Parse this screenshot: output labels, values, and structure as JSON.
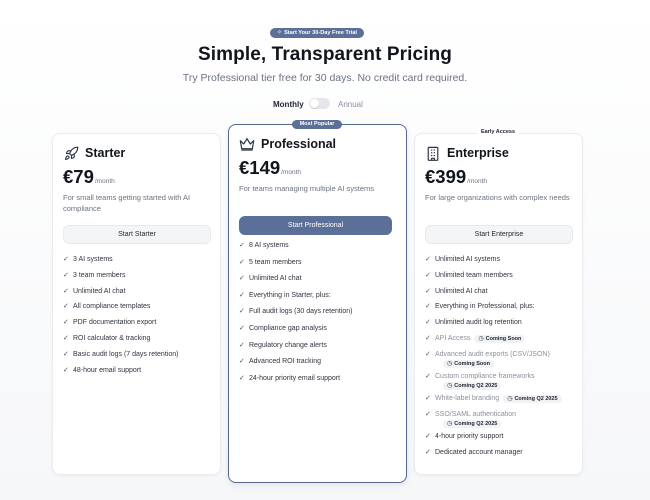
{
  "trial_badge": "Start Your 30-Day Free Trial",
  "title": "Simple, Transparent Pricing",
  "subtitle": "Try Professional tier free for 30 days. No credit card required.",
  "billing": {
    "monthly": "Monthly",
    "annual": "Annual",
    "selected": "Monthly"
  },
  "colors": {
    "accent": "#5b6f99",
    "text": "#11151c",
    "muted": "#6b7280"
  },
  "plans": {
    "starter": {
      "icon": "rocket-icon",
      "name": "Starter",
      "price": "€79",
      "period": "/month",
      "description": "For small teams getting started with AI compliance",
      "cta": "Start Starter",
      "features": [
        "3 AI systems",
        "3 team members",
        "Unlimited AI chat",
        "All compliance templates",
        "PDF documentation export",
        "ROI calculator & tracking",
        "Basic audit logs (7 days retention)",
        "48-hour email support"
      ]
    },
    "professional": {
      "badge": "Most Popular",
      "icon": "crown-icon",
      "name": "Professional",
      "price": "€149",
      "period": "/month",
      "description": "For teams managing multiple AI systems",
      "cta": "Start Professional",
      "features": [
        "8 AI systems",
        "5 team members",
        "Unlimited AI chat",
        "Everything in Starter, plus:",
        "Full audit logs (30 days retention)",
        "Compliance gap analysis",
        "Regulatory change alerts",
        "Advanced ROI tracking",
        "24-hour priority email support"
      ]
    },
    "enterprise": {
      "badge": "Early Access",
      "icon": "building-icon",
      "name": "Enterprise",
      "price": "€399",
      "period": "/month",
      "description": "For large organizations with complex needs",
      "cta": "Start Enterprise",
      "features": [
        {
          "text": "Unlimited AI systems"
        },
        {
          "text": "Unlimited team members"
        },
        {
          "text": "Unlimited AI chat"
        },
        {
          "text": "Everything in Professional, plus:"
        },
        {
          "text": "Unlimited audit log retention"
        },
        {
          "text": "API Access",
          "tag": "Coming Soon"
        },
        {
          "text": "Advanced audit exports (CSV/JSON)",
          "tag": "Coming Soon"
        },
        {
          "text": "Custom compliance frameworks",
          "tag": "Coming Q2 2025"
        },
        {
          "text": "White-label branding",
          "tag": "Coming Q2 2025"
        },
        {
          "text": "SSO/SAML authentication",
          "tag": "Coming Q2 2025"
        },
        {
          "text": "4-hour priority support"
        },
        {
          "text": "Dedicated account manager"
        }
      ]
    }
  }
}
